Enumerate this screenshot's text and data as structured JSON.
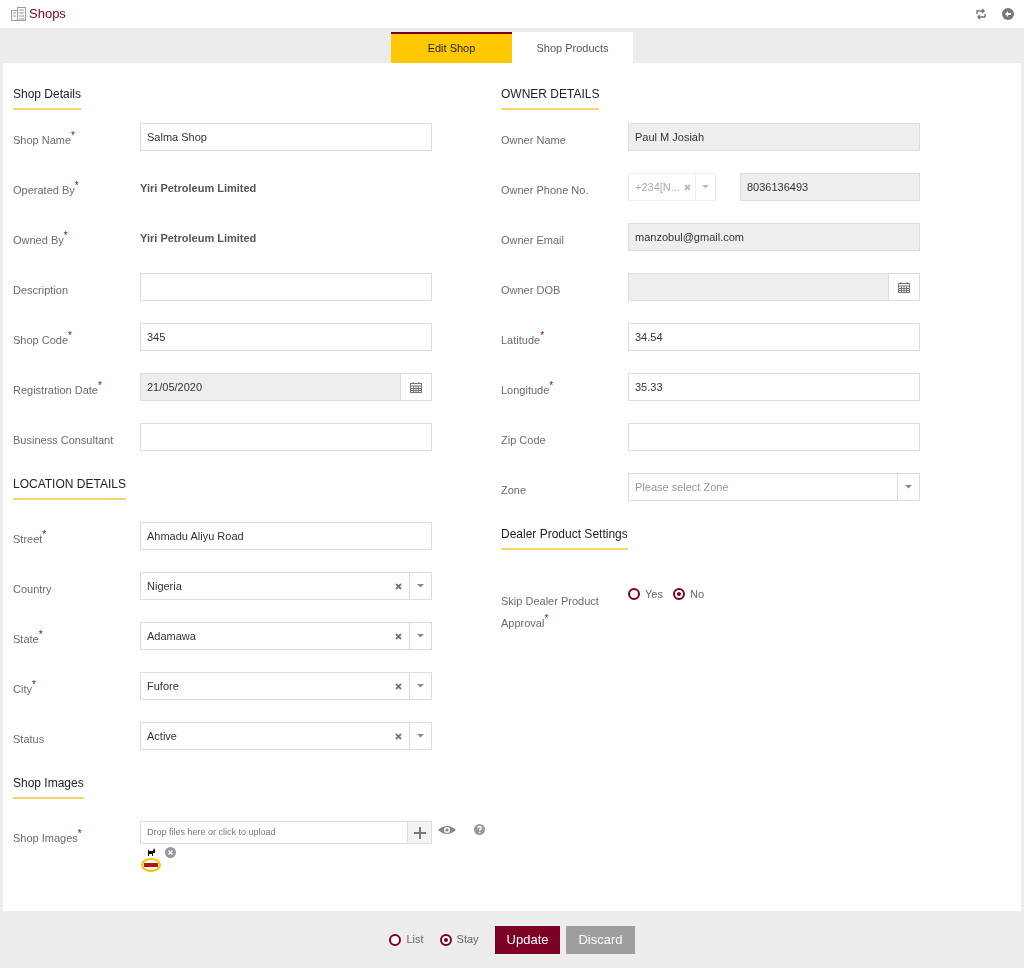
{
  "header": {
    "title": "Shops"
  },
  "tabs": [
    {
      "label": "Edit Shop",
      "selected": true
    },
    {
      "label": "Shop Products",
      "selected": false
    }
  ],
  "left": [
    {
      "kind": "heading",
      "text": "Shop Details"
    },
    {
      "kind": "text",
      "label": "Shop Name$^{*}$",
      "value": "Salma Shop",
      "disabled": false
    },
    {
      "kind": "static",
      "label": "Operated By$^{*}$",
      "value": "Yiri Petroleum Limited"
    },
    {
      "kind": "static",
      "label": "Owned By$^{*}$",
      "value": "Yiri Petroleum Limited"
    },
    {
      "kind": "text",
      "label": "Description",
      "disabled": false
    },
    {
      "kind": "text",
      "label": "Shop Code$^{*}$",
      "value": "345",
      "disabled": false
    },
    {
      "kind": "date",
      "label": "Registration Date$^{*}$",
      "value": "21/05/2020",
      "disabled": true
    },
    {
      "kind": "text",
      "label": "Business Consultant",
      "disabled": false
    },
    {
      "kind": "heading",
      "text": "LOCATION DETAILS"
    },
    {
      "kind": "text",
      "label": "Street$^{*}$",
      "value": "Ahmadu Aliyu Road",
      "disabled": false
    },
    {
      "kind": "select",
      "label": "Country",
      "value": "Nigeria"
    },
    {
      "kind": "select",
      "label": "State$^{*}$",
      "value": "Adamawa"
    },
    {
      "kind": "select",
      "label": "City$^{*}$",
      "value": "Fufore"
    },
    {
      "kind": "select",
      "label": "Status",
      "value": "Active"
    },
    {
      "kind": "heading",
      "text": "Shop Images"
    },
    {
      "kind": "upload",
      "label": "Shop Images$^{*}$",
      "placeholder": "Drop files here or click to upload"
    }
  ],
  "right": [
    {
      "kind": "heading",
      "text": "OWNER DETAILS"
    },
    {
      "kind": "text",
      "label": "Owner Name",
      "value": "Paul M Josiah",
      "disabled": true
    },
    {
      "kind": "phone",
      "label": "Owner Phone No.",
      "code": "+234[N...",
      "number": "8036136493",
      "disabled": true
    },
    {
      "kind": "text",
      "label": "Owner Email",
      "value": "manzobul@gmail.com",
      "disabled": true
    },
    {
      "kind": "date",
      "label": "Owner DOB",
      "disabled": true
    },
    {
      "kind": "text",
      "label": "Latitude$^{*}$",
      "value": "34.54",
      "disabled": false
    },
    {
      "kind": "text",
      "label": "Longitude$^{*}$",
      "value": "35.33",
      "disabled": false
    },
    {
      "kind": "text",
      "label": "Zip Code",
      "disabled": false
    },
    {
      "kind": "select",
      "label": "Zone",
      "placeholder": "Please select Zone"
    },
    {
      "kind": "heading",
      "text": "Dealer Product Settings"
    },
    {
      "kind": "radio",
      "label": "Skip Dealer Product Approval$^{*}$",
      "options": [
        {
          "label": "Yes",
          "selected": false
        },
        {
          "label": "No",
          "selected": true
        }
      ]
    }
  ],
  "footer": {
    "options": [
      {
        "label": "List",
        "selected": false
      },
      {
        "label": "Stay",
        "selected": true
      }
    ],
    "buttons": [
      {
        "label": "Update",
        "kind": "primary"
      },
      {
        "label": "Discard",
        "kind": "secondary"
      }
    ]
  }
}
